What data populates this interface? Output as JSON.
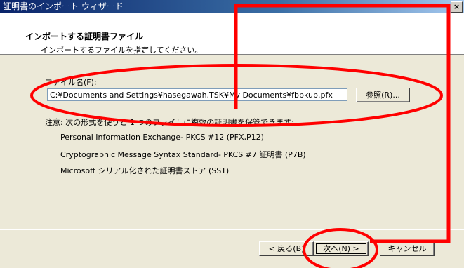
{
  "window": {
    "title": "証明書のインポート ウィザード",
    "close_glyph": "×"
  },
  "header": {
    "title": "インポートする証明書ファイル",
    "subtitle": "インポートするファイルを指定してください。"
  },
  "file_section": {
    "label": "ファイル名(F):",
    "value": "C:¥Documents and Settings¥hasegawah.TSK¥My Documents¥fbbkup.pfx",
    "browse_label": "参照(R)..."
  },
  "note": "注意: 次の形式を使うと 1 つのファイルに複数の証明書を保管できます:",
  "formats": [
    "Personal Information Exchange- PKCS #12 (PFX,P12)",
    "Cryptographic Message Syntax Standard- PKCS #7 証明書 (P7B)",
    "Microsoft シリアル化された証明書ストア (SST)"
  ],
  "buttons": {
    "back": "< 戻る(B)",
    "next": "次へ(N) >",
    "cancel": "キャンセル"
  },
  "colors": {
    "annotation": "#ff0000"
  }
}
